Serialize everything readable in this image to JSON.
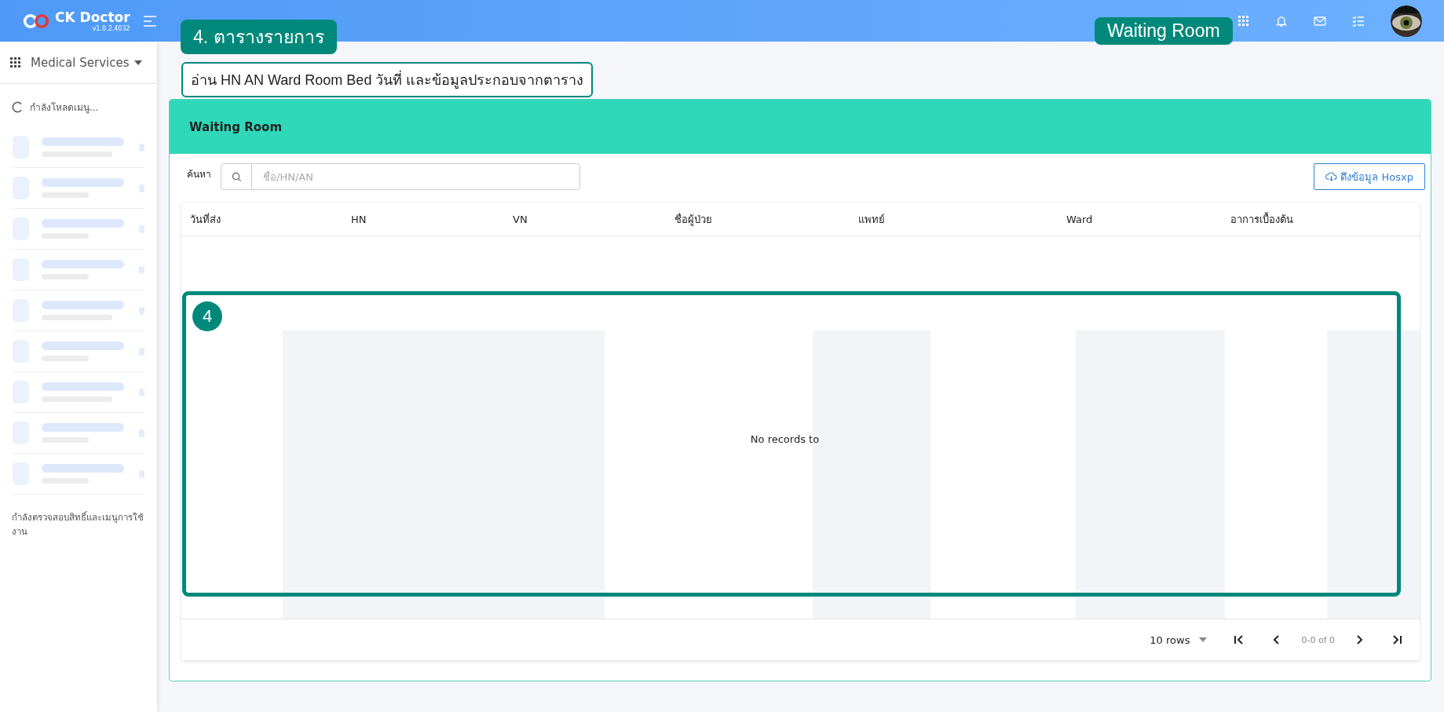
{
  "header": {
    "app_name": "CK Doctor",
    "version": "v1.0.2.4032"
  },
  "sidebar": {
    "menu_title": "Medical Services",
    "loading_text": "กำลังโหลดเมนู...",
    "status_text": "กำลังตรวจสอบสิทธิ์และเมนูการใช้งาน"
  },
  "panel": {
    "title": "Waiting Room",
    "search": {
      "label": "ค้นหา",
      "placeholder": "ชื่อ/HN/AN"
    },
    "fetch_button": "ดึงข้อมูล Hosxp",
    "table": {
      "columns": [
        "วันที่ส่ง",
        "HN",
        "VN",
        "ชื่อผู้ป่วย",
        "แพทย์",
        "Ward",
        "อาการเบื้องต้น"
      ],
      "empty_text": "No records to"
    },
    "pagination": {
      "rows_per_page": "10 rows",
      "range": "0-0 of 0"
    }
  },
  "annotations": [
    {
      "kind": "label",
      "text": "4. ตารางรายการ"
    },
    {
      "kind": "label",
      "text": "Waiting Room"
    },
    {
      "kind": "note",
      "text": "อ่าน HN AN Ward Room Bed วันที่ และข้อมูลประกอบจากตาราง"
    },
    {
      "kind": "frame",
      "text": "4"
    }
  ]
}
